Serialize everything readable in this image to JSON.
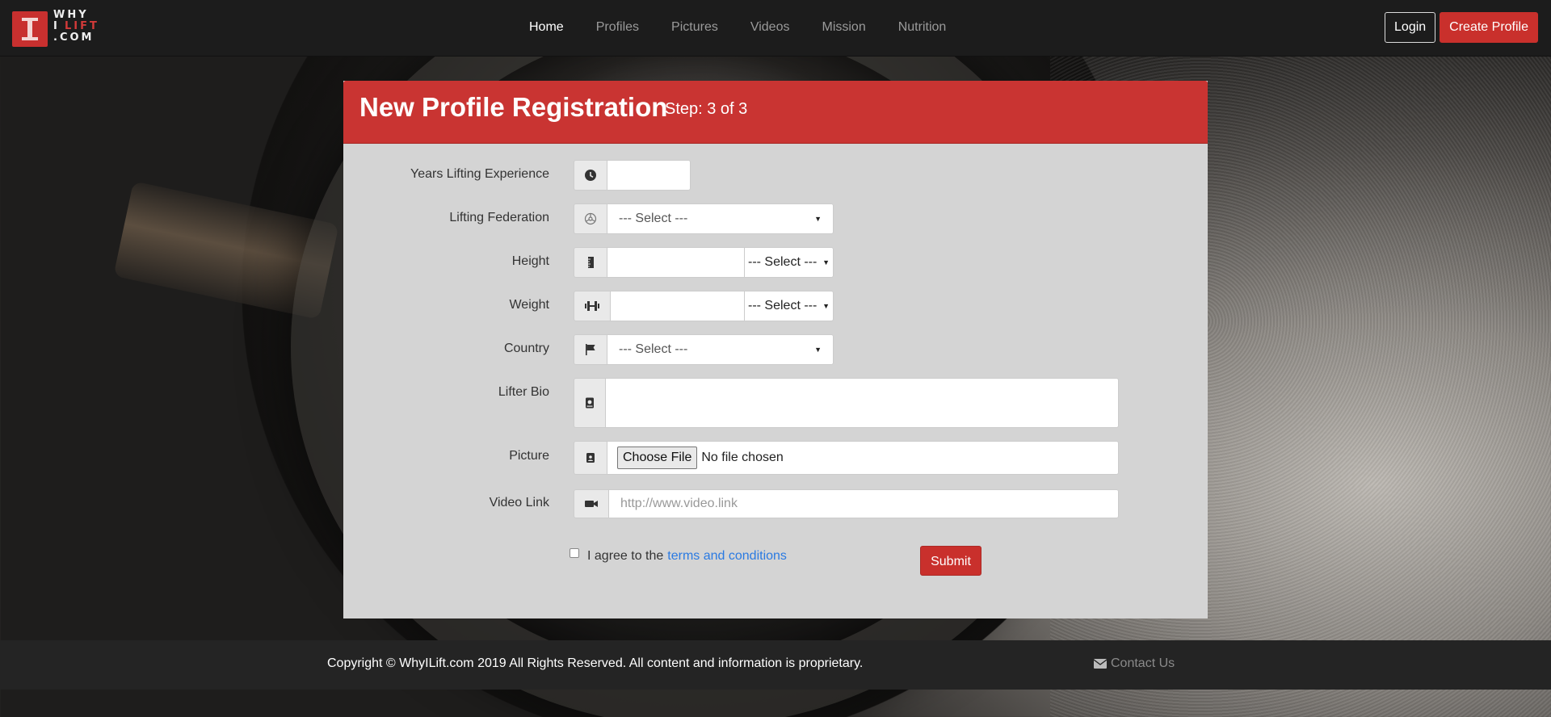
{
  "brand": {
    "logo_lines": [
      "WHY",
      "I",
      "LIFT",
      ".COM"
    ],
    "brand_color": "#c9302c"
  },
  "nav": {
    "links": [
      {
        "label": "Home",
        "active": true
      },
      {
        "label": "Profiles",
        "active": false
      },
      {
        "label": "Pictures",
        "active": false
      },
      {
        "label": "Videos",
        "active": false
      },
      {
        "label": "Mission",
        "active": false
      },
      {
        "label": "Nutrition",
        "active": false
      }
    ],
    "login_label": "Login",
    "create_label": "Create Profile"
  },
  "panel": {
    "title": "New Profile Registration",
    "step": "Step: 3 of 3"
  },
  "form": {
    "years": {
      "label": "Years Lifting Experience",
      "icon": "clock-icon",
      "value": ""
    },
    "federation": {
      "label": "Lifting Federation",
      "icon": "federation-icon",
      "selected": "--- Select ---"
    },
    "height": {
      "label": "Height",
      "icon": "ruler-icon",
      "value": "",
      "unit": "--- Select ---"
    },
    "weight": {
      "label": "Weight",
      "icon": "dumbbell-icon",
      "value": "",
      "unit": "--- Select ---"
    },
    "country": {
      "label": "Country",
      "icon": "flag-icon",
      "selected": "--- Select ---"
    },
    "bio": {
      "label": "Lifter Bio",
      "icon": "book-icon",
      "value": ""
    },
    "picture": {
      "label": "Picture",
      "icon": "contact-icon",
      "button": "Choose File",
      "status": "No file chosen"
    },
    "video": {
      "label": "Video Link",
      "icon": "video-icon",
      "placeholder": "http://www.video.link"
    },
    "terms_text": "I agree to the",
    "terms_link": "terms and conditions",
    "submit_label": "Submit"
  },
  "footer": {
    "copyright": "Copyright © WhyILift.com 2019 All Rights Reserved. All content and information is proprietary.",
    "contact": "Contact Us"
  }
}
